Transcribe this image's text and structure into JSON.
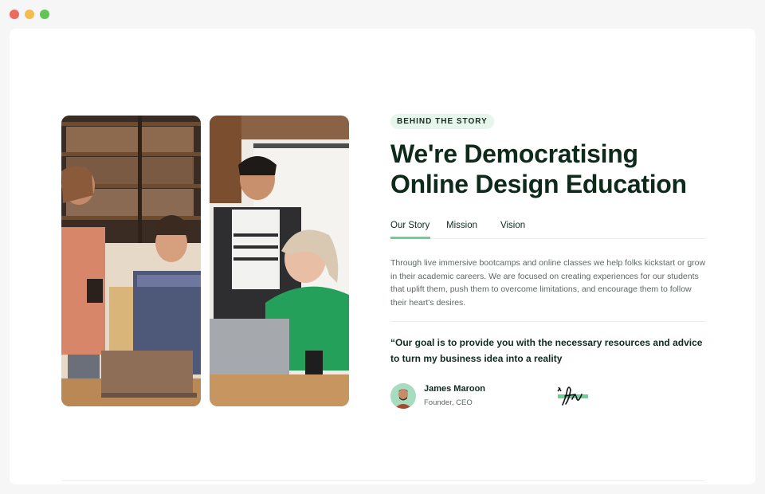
{
  "window": {
    "controls": [
      "close",
      "minimize",
      "zoom"
    ]
  },
  "section": {
    "eyebrow": "BEHIND THE STORY",
    "headline": "We're Democratising Online Design Education",
    "tabs": [
      {
        "label": "Our Story",
        "active": true
      },
      {
        "label": "Mission",
        "active": false
      },
      {
        "label": "Vision",
        "active": false
      }
    ],
    "body": "Through live immersive bootcamps and online classes we help folks kickstart or grow in their academic careers. We are focused on creating experiences for our students that uplift them, push them to overcome limitations, and encourage them to follow their heart's desires.",
    "quote": "“Our goal is to provide you with the necessary resources and advice to turn my business idea into a reality",
    "author": {
      "name": "James Maroon",
      "role": "Founder, CEO"
    }
  },
  "images": {
    "left_photo": "students-with-laptop-photo",
    "right_photo": "students-green-sweater-photo"
  },
  "colors": {
    "accent": "#6ccf98",
    "eyebrow_bg": "#e6f6ec",
    "headline": "#0d2a1b",
    "body_text": "#5d6863"
  }
}
